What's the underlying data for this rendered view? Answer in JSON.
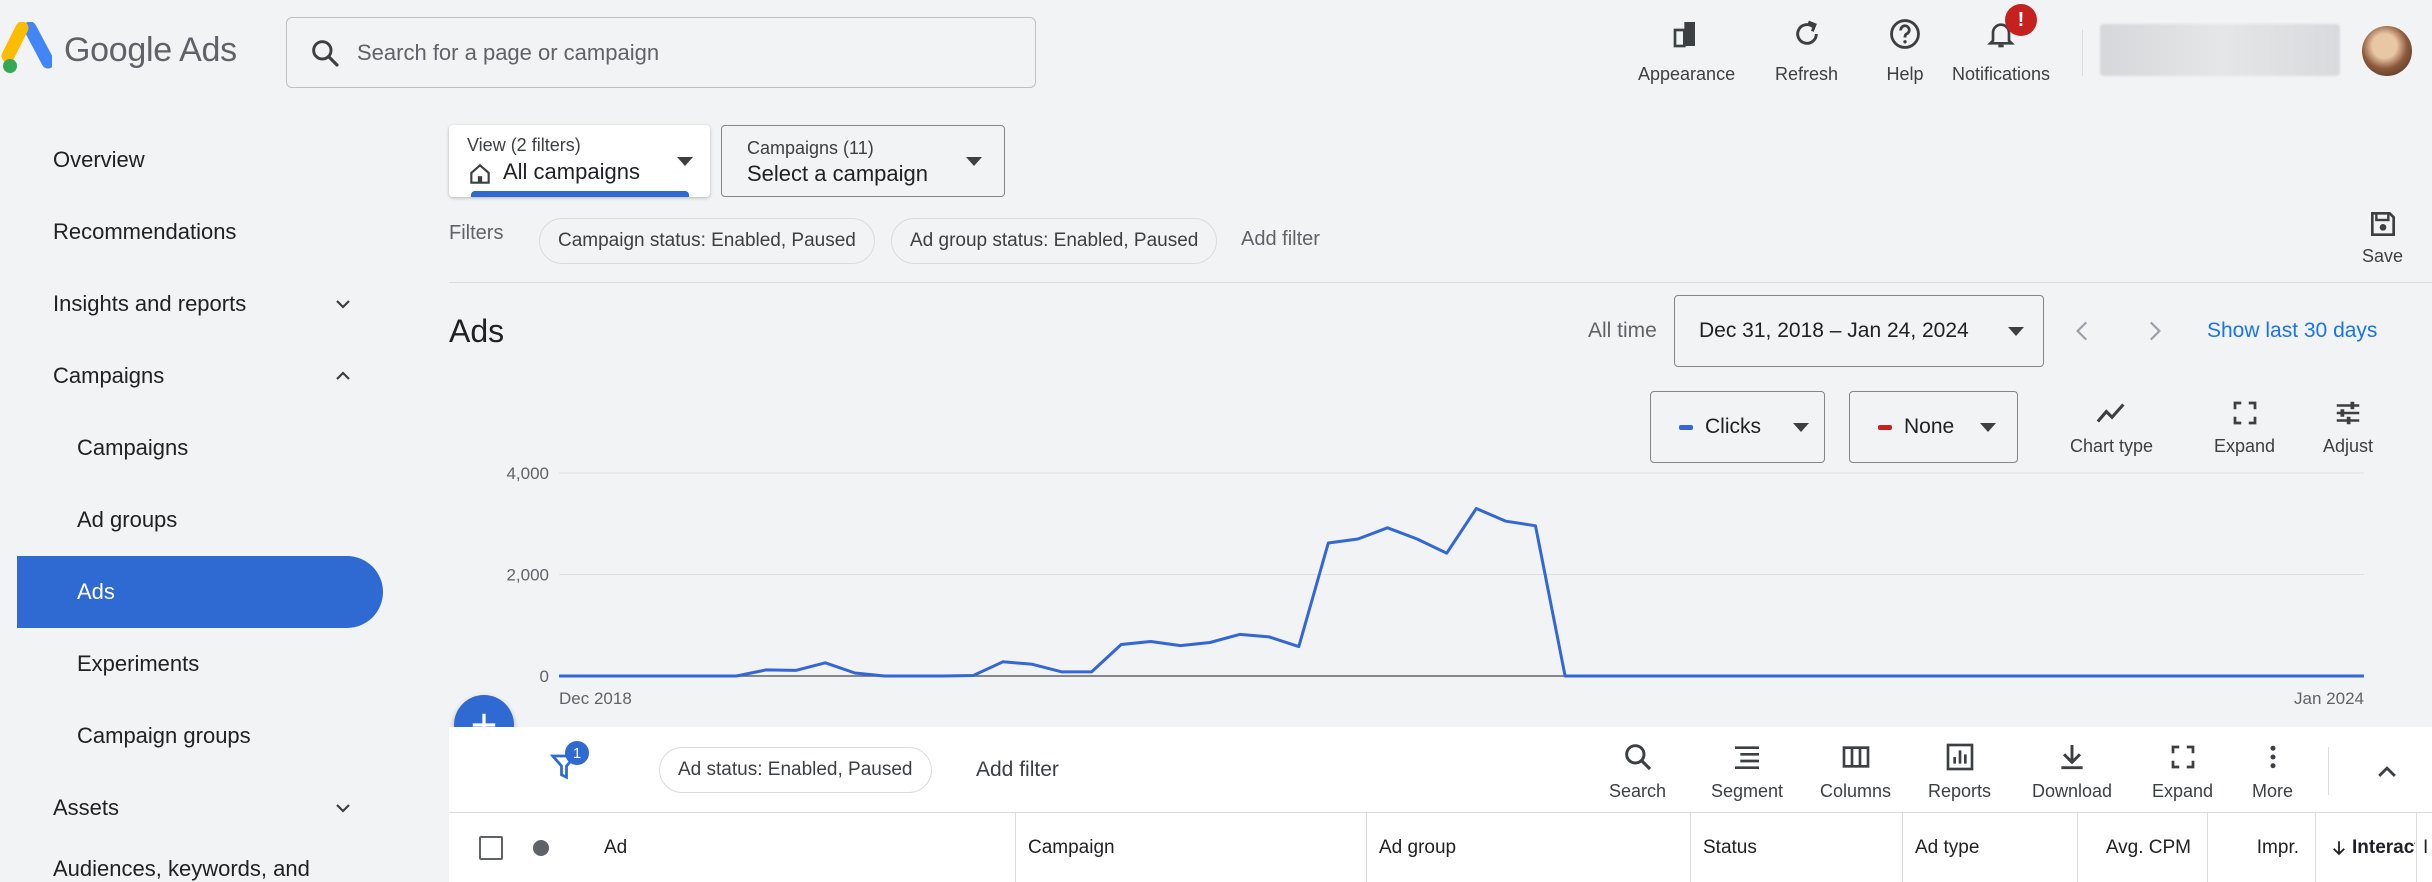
{
  "app": {
    "logo_text": "Google Ads",
    "search_placeholder": "Search for a page or campaign"
  },
  "top_actions": [
    {
      "label": "Appearance",
      "icon": "appearance-icon"
    },
    {
      "label": "Refresh",
      "icon": "refresh-icon"
    },
    {
      "label": "Help",
      "icon": "help-icon"
    },
    {
      "label": "Notifications",
      "icon": "bell-icon",
      "badge": "!"
    }
  ],
  "sidebar": {
    "items": [
      {
        "label": "Overview"
      },
      {
        "label": "Recommendations"
      },
      {
        "label": "Insights and reports",
        "chevron": "down"
      },
      {
        "label": "Campaigns",
        "chevron": "up"
      },
      {
        "label": "Campaigns"
      },
      {
        "label": "Ad groups"
      },
      {
        "label": "Ads",
        "active": true
      },
      {
        "label": "Experiments"
      },
      {
        "label": "Campaign groups"
      },
      {
        "label": "Assets",
        "chevron": "down"
      },
      {
        "label": "Audiences, keywords, and",
        "chevron": "down"
      }
    ]
  },
  "view_selector": {
    "caption": "View (2 filters)",
    "value": "All campaigns"
  },
  "campaign_selector": {
    "caption": "Campaigns (11)",
    "value": "Select a campaign"
  },
  "filters": {
    "label": "Filters",
    "chips": [
      "Campaign status: Enabled, Paused",
      "Ad group status: Enabled, Paused"
    ],
    "add_filter": "Add filter",
    "save_label": "Save"
  },
  "page": {
    "title": "Ads",
    "range_label": "All time",
    "date_range": "Dec 31, 2018 – Jan 24, 2024",
    "show_last": "Show last 30 days"
  },
  "metrics": {
    "primary": {
      "label": "Clicks",
      "color": "#3367d6"
    },
    "secondary": {
      "label": "None",
      "color": "#c5221f"
    }
  },
  "chart_tools": [
    {
      "label": "Chart type",
      "icon": "chart-line-icon"
    },
    {
      "label": "Expand",
      "icon": "expand-icon"
    },
    {
      "label": "Adjust",
      "icon": "tune-icon"
    }
  ],
  "chart_data": {
    "type": "line",
    "x_start_label": "Dec 2018",
    "x_end_label": "Jan 2024",
    "ylim": [
      0,
      4000
    ],
    "y_ticks": [
      "0",
      "2,000",
      "4,000"
    ],
    "y_tick_values": [
      0,
      2000,
      4000
    ],
    "series": [
      {
        "color": "#3367d6",
        "values": [
          0,
          0,
          0,
          0,
          0,
          0,
          0,
          120,
          110,
          260,
          60,
          0,
          0,
          0,
          10,
          280,
          230,
          80,
          80,
          620,
          680,
          600,
          660,
          820,
          770,
          580,
          2620,
          2700,
          2920,
          2700,
          2420,
          3300,
          3050,
          2960,
          0,
          0,
          0,
          0,
          0,
          0,
          0,
          0,
          0,
          0,
          0,
          0,
          0,
          0,
          0,
          0,
          0,
          0,
          0,
          0,
          0,
          0,
          0,
          0,
          0,
          0,
          0,
          0
        ]
      }
    ]
  },
  "table": {
    "filter_count": "1",
    "status_chip": "Ad status: Enabled, Paused",
    "add_filter": "Add filter",
    "tools": [
      {
        "label": "Search",
        "icon": "search-icon"
      },
      {
        "label": "Segment",
        "icon": "segment-icon"
      },
      {
        "label": "Columns",
        "icon": "columns-icon"
      },
      {
        "label": "Reports",
        "icon": "reports-icon"
      },
      {
        "label": "Download",
        "icon": "download-icon"
      },
      {
        "label": "Expand",
        "icon": "expand-icon"
      },
      {
        "label": "More",
        "icon": "more-vert-icon"
      }
    ],
    "columns": [
      "Ad",
      "Campaign",
      "Ad group",
      "Status",
      "Ad type",
      "Avg. CPM",
      "Impr.",
      "Interact",
      "I"
    ]
  }
}
